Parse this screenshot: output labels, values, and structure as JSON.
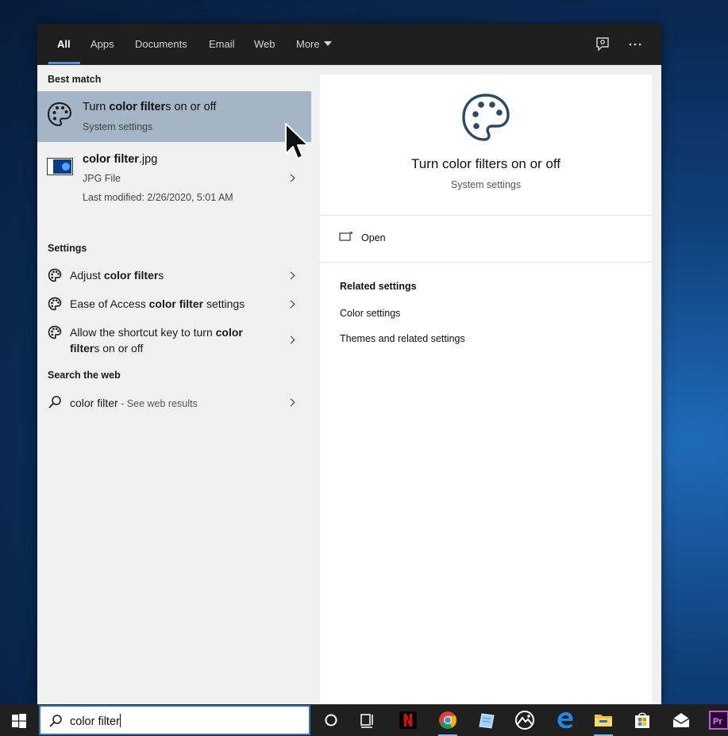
{
  "tabs": [
    {
      "label": "All",
      "active": true
    },
    {
      "label": "Apps"
    },
    {
      "label": "Documents"
    },
    {
      "label": "Email"
    },
    {
      "label": "Web"
    },
    {
      "label": "More"
    }
  ],
  "sections": {
    "best_match": "Best match",
    "settings": "Settings",
    "search_web": "Search the web"
  },
  "best_match": {
    "title_pre": "Turn ",
    "title_bold": "color filter",
    "title_post": "s on or off",
    "subtitle": "System settings"
  },
  "file_result": {
    "title_bold": "color filter",
    "title_post": ".jpg",
    "type": "JPG File",
    "modified": "Last modified: 2/26/2020, 5:01 AM"
  },
  "settings_items": [
    {
      "pre": "Adjust ",
      "bold": "color filter",
      "post": "s"
    },
    {
      "pre": "Ease of Access ",
      "bold": "color filter",
      "post": " settings"
    },
    {
      "pre": "Allow the shortcut key to turn ",
      "bold": "color",
      "line2_bold": "filter",
      "line2_post": "s on or off"
    }
  ],
  "web_item": {
    "query": "color filter",
    "suffix": " - See web results"
  },
  "preview": {
    "title": "Turn color filters on or off",
    "subtitle": "System settings",
    "open_label": "Open",
    "related_header": "Related settings",
    "related": [
      "Color settings",
      "Themes and related settings"
    ]
  },
  "taskbar": {
    "search_value": "color filter"
  },
  "colors": {
    "accent": "#2f73c0",
    "selected_row": "#a3b5c6",
    "palette_icon": "#2b4a66"
  }
}
